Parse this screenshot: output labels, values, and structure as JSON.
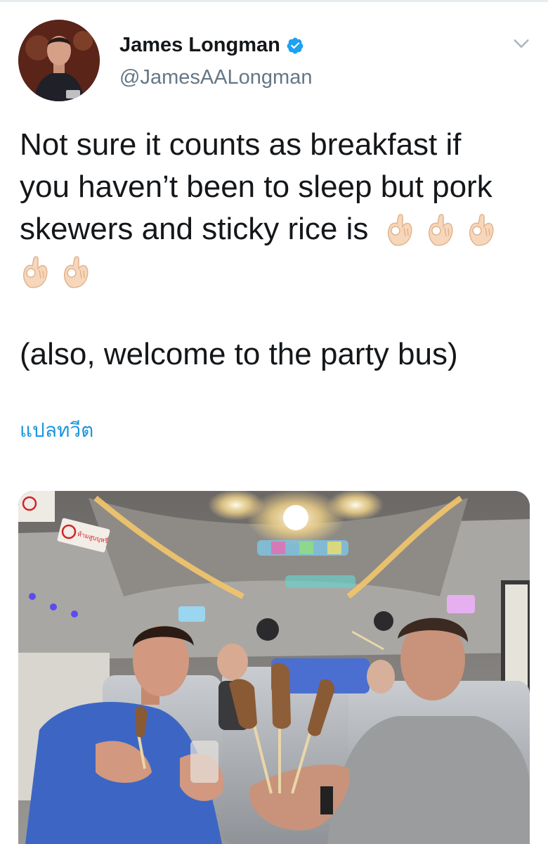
{
  "author": {
    "display_name": "James Longman",
    "handle": "@JamesAALongman",
    "verified": true
  },
  "tweet": {
    "lines": [
      "Not sure it counts as breakfast if",
      "you haven’t been to sleep but pork",
      "skewers and sticky rice is"
    ],
    "emoji": "👌🏻",
    "emoji_count": 5,
    "second_paragraph": "(also, welcome to the party bus)",
    "translate_label": "แปลทวีต"
  },
  "media": {
    "sign_text": "ห้ามสูบบุหรี่"
  },
  "colors": {
    "verified_blue": "#1da1f2",
    "link_blue": "#1b95e0",
    "secondary_text": "#657786"
  }
}
